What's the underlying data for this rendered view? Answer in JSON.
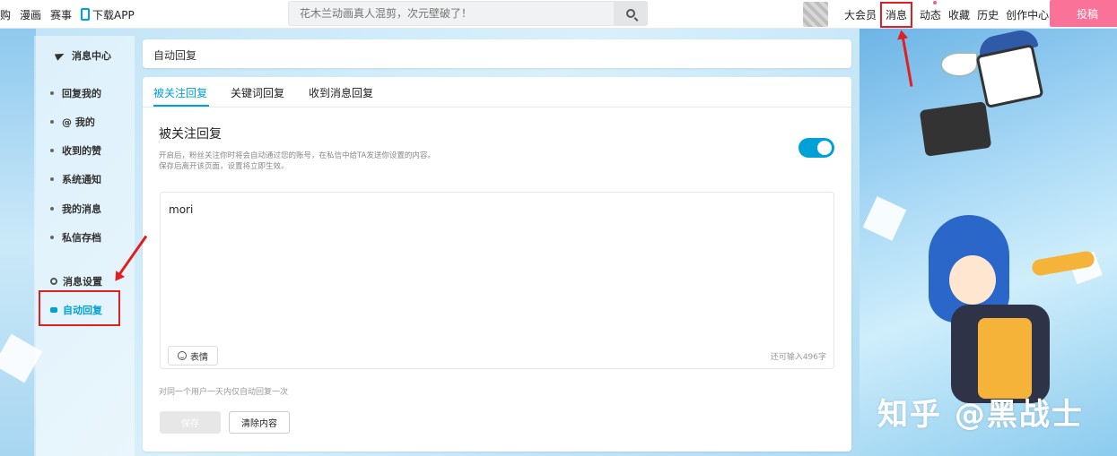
{
  "topbar": {
    "left_nav": [
      "购",
      "漫画",
      "赛事",
      "下载APP"
    ],
    "search_placeholder": "花木兰动画真人混剪，次元壁破了！",
    "right_nav": [
      "大会员",
      "消息",
      "动态",
      "收藏",
      "历史",
      "创作中心"
    ],
    "upload_label": "投稿"
  },
  "sidebar": {
    "header": "消息中心",
    "items": [
      "回复我的",
      "@ 我的",
      "收到的赞",
      "系统通知",
      "我的消息",
      "私信存档"
    ],
    "settings_label": "消息设置",
    "auto_reply_label": "自动回复"
  },
  "main": {
    "page_title": "自动回复",
    "tabs": [
      "被关注回复",
      "关键词回复",
      "收到消息回复"
    ],
    "section_title": "被关注回复",
    "desc_line1": "开启后，粉丝关注你时将会自动通过您的账号，在私信中给TA发送你设置的内容。",
    "desc_line2": "保存后离开该页面，设置将立即生效。",
    "toggle_on": true,
    "reply_text": "mori",
    "emoji_label": "表情",
    "char_count": "还可输入496字",
    "note": "对同一个用户一天内仅自动回复一次",
    "save_label": "保存",
    "clear_label": "清除内容"
  },
  "watermark": "知乎 @黑战士",
  "colors": {
    "accent": "#00a1d6",
    "pink": "#fb7299",
    "annotation": "#e02020"
  }
}
